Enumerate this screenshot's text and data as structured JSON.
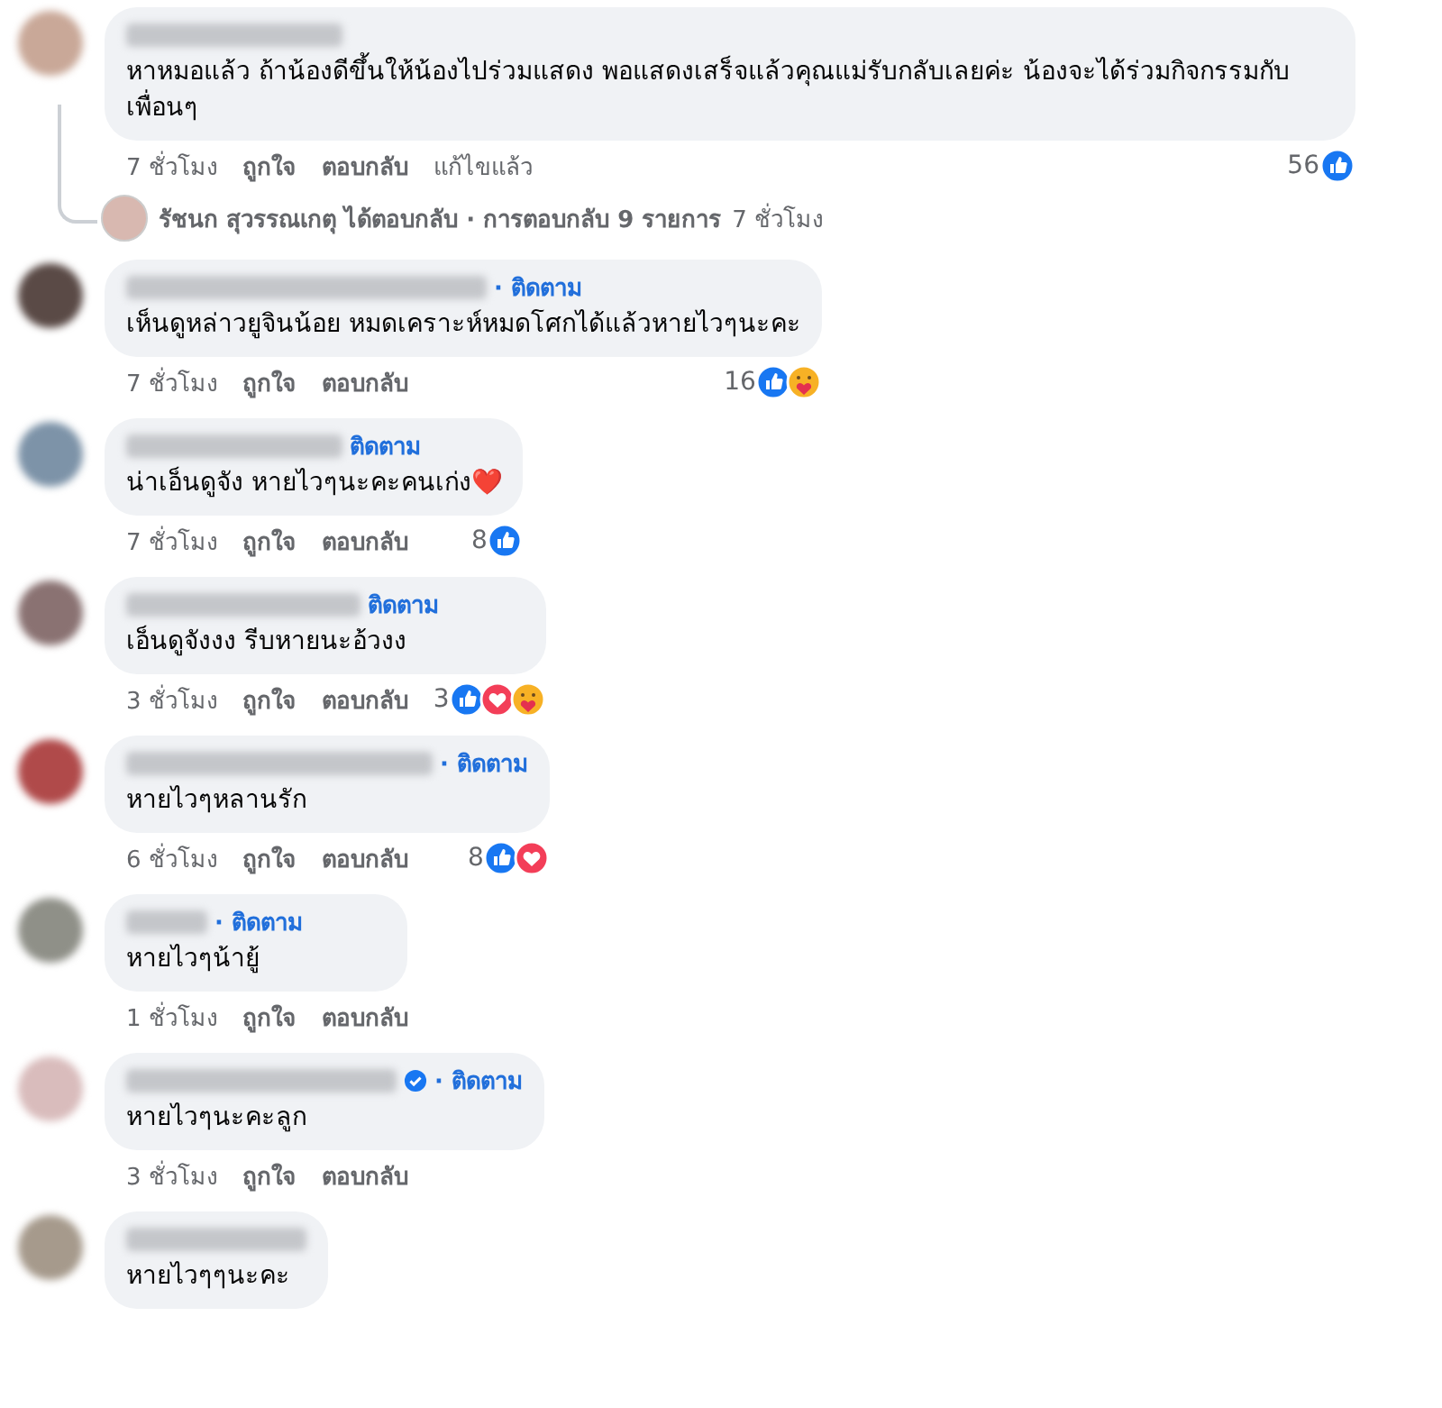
{
  "comments": [
    {
      "color": "#c9a898",
      "verified": false,
      "text": "หาหมอแล้ว ถ้าน้องดีขึ้นให้น้องไปร่วมแสดง พอแสดงเสร็จแล้วคุณแม่รับกลับเลยค่ะ น้องจะได้ร่วมกิจกรรมกับเพื่อนๆ",
      "time": "7 ชั่วโมง",
      "actions": [
        "ถูกใจ",
        "ตอบกลับ"
      ],
      "edited": "แก้ไขแล้ว",
      "reactions": {
        "count": "56",
        "icons": [
          {
            "kind": "like"
          }
        ]
      },
      "replies": {
        "link": "รัชนก สุวรรณเกตุ ได้ตอบกลับ · การตอบกลับ 9 รายการ",
        "time": "7 ชั่วโมง"
      }
    },
    {
      "color": "#5a4a46",
      "follow": "· ติดตาม",
      "verified": false,
      "text": "เห็นดูหล่าวยูจินน้อย หมดเคราะห์หมดโศกได้แล้วหายไวๆนะคะ",
      "time": "7 ชั่วโมง",
      "actions": [
        "ถูกใจ",
        "ตอบกลับ"
      ],
      "reactions": {
        "count": "16",
        "icons": [
          {
            "kind": "like"
          },
          {
            "kind": "care"
          }
        ]
      }
    },
    {
      "color": "#7d93a8",
      "follow": "ติดตาม",
      "verified": false,
      "text": "น่าเอ็นดูจัง หายไวๆนะคะคนเก่ง❤️",
      "time": "7 ชั่วโมง",
      "actions": [
        "ถูกใจ",
        "ตอบกลับ"
      ],
      "reactions": {
        "count": "8",
        "icons": [
          {
            "kind": "like"
          }
        ]
      }
    },
    {
      "color": "#8a7272",
      "follow": "ติดตาม",
      "verified": false,
      "text": "เอ็นดูจังงง รีบหายนะอ้วงง",
      "time": "3 ชั่วโมง",
      "actions": [
        "ถูกใจ",
        "ตอบกลับ"
      ],
      "reactions": {
        "count": "3",
        "icons": [
          {
            "kind": "like"
          },
          {
            "kind": "love"
          },
          {
            "kind": "care"
          }
        ]
      }
    },
    {
      "color": "#b04a4a",
      "follow": "· ติดตาม",
      "verified": false,
      "text": "หายไวๆหลานรัก",
      "time": "6 ชั่วโมง",
      "actions": [
        "ถูกใจ",
        "ตอบกลับ"
      ],
      "reactions": {
        "count": "8",
        "icons": [
          {
            "kind": "like"
          },
          {
            "kind": "love"
          }
        ]
      }
    },
    {
      "color": "#8f9088",
      "follow": "· ติดตาม",
      "verified": false,
      "text": "หายไวๆน้ายู้",
      "time": "1 ชั่วโมง",
      "actions": [
        "ถูกใจ",
        "ตอบกลับ"
      ]
    },
    {
      "color": "#d9bcbc",
      "follow": "· ติดตาม",
      "verified": true,
      "text": "หายไวๆนะคะลูก",
      "time": "3 ชั่วโมง",
      "actions": [
        "ถูกใจ",
        "ตอบกลับ"
      ]
    },
    {
      "color": "#a69a8c",
      "verified": false,
      "text": "หายไวๆๆนะคะ"
    }
  ]
}
